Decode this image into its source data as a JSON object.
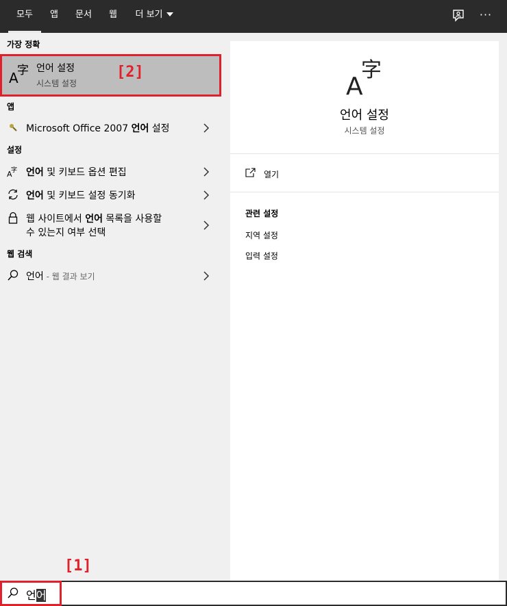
{
  "tabs": [
    "모두",
    "앱",
    "문서",
    "웹",
    "더 보기"
  ],
  "top_icons": [
    "feedback-icon",
    "more-options-icon"
  ],
  "more_dots": "···",
  "sections": {
    "best": "가장 정확",
    "apps": "앱",
    "settings": "설정",
    "web": "웹 검색"
  },
  "best_match": {
    "title": "언어 설정",
    "subtitle": "시스템 설정"
  },
  "annotations": {
    "one": "[1]",
    "two": "[2]"
  },
  "app_result": {
    "prefix": "Microsoft Office 2007 ",
    "bold": "언어",
    "suffix": " 설정"
  },
  "settings_results": [
    {
      "bold": "언어",
      "rest": " 및 키보드 옵션 편집"
    },
    {
      "bold": "언어",
      "rest": " 및 키보드 설정 동기화"
    },
    {
      "line1_prefix": "웹 사이트에서 ",
      "bold": "언어",
      "line1_suffix": " 목록을 사용할",
      "line2": "수 있는지 여부 선택"
    }
  ],
  "web_result": {
    "query": "언어",
    "suffix": " - 웹 결과 보기"
  },
  "preview": {
    "title": "언어 설정",
    "subtitle": "시스템 설정",
    "open": "열기",
    "related_heading": "관련 설정",
    "related": [
      "지역 설정",
      "입력 설정"
    ]
  },
  "search": {
    "typed": "언",
    "selected": "어"
  }
}
